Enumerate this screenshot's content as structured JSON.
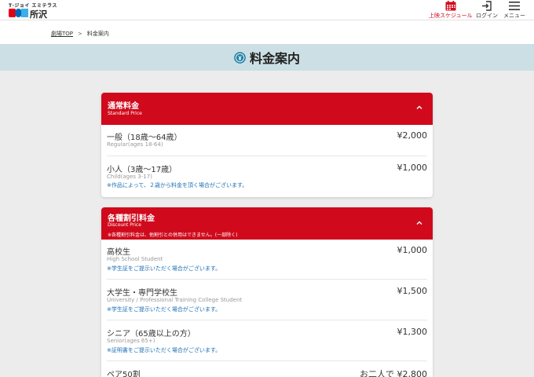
{
  "header": {
    "logo_top": "T·ジョイ エミテラス",
    "logo_name": "所沢",
    "nav": {
      "schedule": "上映スケジュール",
      "login": "ログイン",
      "menu": "メニュー"
    },
    "accent_color": "#d00a1c"
  },
  "breadcrumb": {
    "home": "劇場TOP",
    "separator": ">",
    "current": "料金案内"
  },
  "page_title": "料金案内",
  "sections": [
    {
      "title": "通常料金",
      "subtitle": "Standard Price",
      "rows": [
        {
          "name": "一般（18歳～64歳）",
          "en": "Regular(ages 18-64)",
          "price": "¥2,000"
        },
        {
          "name": "小人（3歳～17歳）",
          "en": "Child(ages 3-17)",
          "note": "※作品によって、２歳から料金を頂く場合がございます。",
          "price": "¥1,000"
        }
      ]
    },
    {
      "title": "各種割引料金",
      "subtitle": "Discount Price",
      "note": "※各種割引料金は、他割引との併用はできません。(一部除く)",
      "rows": [
        {
          "name": "高校生",
          "en": "High School Student",
          "note": "※学生証をご提示いただく場合がございます。",
          "price": "¥1,000"
        },
        {
          "name": "大学生・専門学校生",
          "en": "University / Professional Training College Student",
          "note": "※学生証をご提示いただく場合がございます。",
          "price": "¥1,500"
        },
        {
          "name": "シニア（65歳以上の方）",
          "en": "Senior(ages 65+)",
          "note": "※証明書をご提示いただく場合がございます。",
          "price": "¥1,300"
        },
        {
          "name": "ペア50割",
          "price": "お二人で ¥2,800"
        }
      ]
    }
  ]
}
